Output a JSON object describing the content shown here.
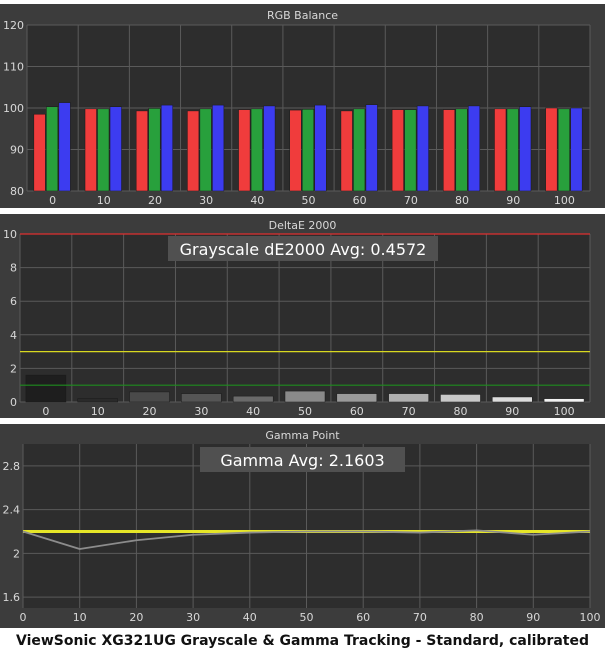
{
  "caption": "ViewSonic XG321UG Grayscale & Gamma Tracking - Standard, calibrated",
  "colors": {
    "panel_bg": "#3c3c3c",
    "plot_bg": "#2d2d2d",
    "grid": "#5a5a5a",
    "text": "#d8d8d8",
    "red": "#f03c3c",
    "green": "#28a03c",
    "blue": "#3c3cf0",
    "threshold_red": "#e03030",
    "threshold_yellow": "#d8d820",
    "threshold_green": "#1e8c1e",
    "gamma_target": "#e6e628",
    "gamma_measured": "#8c8c8c"
  },
  "chart_data": [
    {
      "type": "bar",
      "title": "RGB Balance",
      "categories": [
        "0",
        "10",
        "20",
        "30",
        "40",
        "50",
        "60",
        "70",
        "80",
        "90",
        "100"
      ],
      "ylim": [
        80,
        120
      ],
      "yticks": [
        80,
        90,
        100,
        110,
        120
      ],
      "grid": true,
      "series": [
        {
          "color": "red",
          "values": [
            98.5,
            99.8,
            99.3,
            99.3,
            99.6,
            99.5,
            99.3,
            99.6,
            99.6,
            99.8,
            100.0
          ]
        },
        {
          "color": "green",
          "values": [
            100.3,
            99.8,
            99.9,
            99.8,
            99.8,
            99.7,
            99.8,
            99.6,
            99.8,
            99.8,
            99.8
          ]
        },
        {
          "color": "blue",
          "values": [
            101.3,
            100.3,
            100.7,
            100.7,
            100.5,
            100.7,
            100.8,
            100.5,
            100.5,
            100.3,
            100.0
          ]
        }
      ]
    },
    {
      "type": "bar",
      "title": "DeltaE 2000",
      "annotation": "Grayscale dE2000 Avg: 0.4572",
      "categories": [
        "0",
        "10",
        "20",
        "30",
        "40",
        "50",
        "60",
        "70",
        "80",
        "90",
        "100"
      ],
      "ylim": [
        0,
        10
      ],
      "yticks": [
        0,
        2,
        4,
        6,
        8,
        10
      ],
      "grid": true,
      "thresholds": [
        {
          "value": 10,
          "color": "threshold_red"
        },
        {
          "value": 3,
          "color": "threshold_yellow"
        },
        {
          "value": 1,
          "color": "threshold_green"
        }
      ],
      "values": [
        1.6,
        0.2,
        0.6,
        0.5,
        0.35,
        0.65,
        0.5,
        0.5,
        0.45,
        0.3,
        0.2
      ],
      "bar_shades": [
        "#1e1e1e",
        "#2a2a2a",
        "#4a4a4a",
        "#555555",
        "#6a6a6a",
        "#8a8a8a",
        "#9a9a9a",
        "#b0b0b0",
        "#c8c8c8",
        "#dcdcdc",
        "#f2f2f2"
      ]
    },
    {
      "type": "line",
      "title": "Gamma Point",
      "annotation": "Gamma Avg: 2.1603",
      "x": [
        0,
        10,
        20,
        30,
        40,
        50,
        60,
        70,
        80,
        90,
        100
      ],
      "xlim": [
        0,
        100
      ],
      "xticks": [
        0,
        10,
        20,
        30,
        40,
        50,
        60,
        70,
        80,
        90,
        100
      ],
      "ylim": [
        1.5,
        3.0
      ],
      "yticks": [
        1.6,
        2,
        2.4,
        2.8
      ],
      "grid": true,
      "series": [
        {
          "color": "gamma_target",
          "values": [
            2.2,
            2.2,
            2.2,
            2.2,
            2.2,
            2.2,
            2.2,
            2.2,
            2.2,
            2.2,
            2.2
          ]
        },
        {
          "color": "gamma_measured",
          "values": [
            2.2,
            2.04,
            2.12,
            2.17,
            2.19,
            2.2,
            2.2,
            2.19,
            2.21,
            2.17,
            2.2
          ]
        }
      ]
    }
  ]
}
